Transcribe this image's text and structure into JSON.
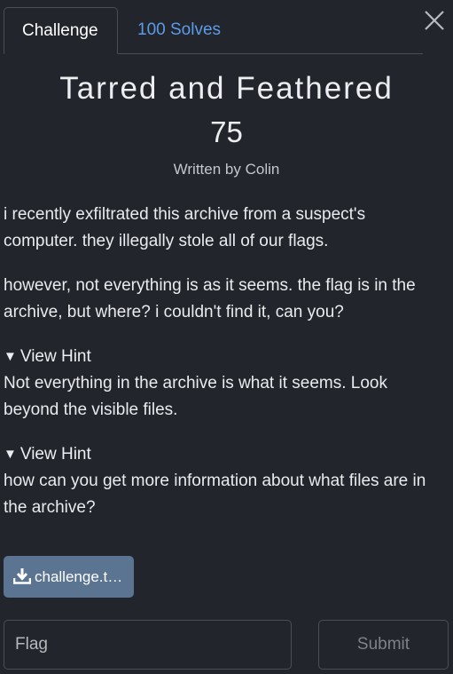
{
  "tabs": {
    "challenge": "Challenge",
    "solves": "100 Solves"
  },
  "challenge": {
    "title": "Tarred and Feathered",
    "points": "75",
    "author": "Written by Colin",
    "description": [
      "i recently exfiltrated this archive from a suspect's computer. they illegally stole all of our flags.",
      "however, not everything is as it seems. the flag is in the archive, but where? i couldn't find it, can you?"
    ]
  },
  "hints": [
    {
      "toggle_icon": "▼",
      "label": "View Hint",
      "text": "Not everything in the archive is what it seems. Look beyond the visible files."
    },
    {
      "toggle_icon": "▼",
      "label": "View Hint",
      "text": "how can you get more information about what files are in the archive?"
    }
  ],
  "files": [
    {
      "icon": "download-icon",
      "label": "challenge.t…"
    }
  ],
  "submission": {
    "placeholder": "Flag",
    "value": "",
    "submit_label": "Submit"
  },
  "icons": {
    "close": "close-icon",
    "download": "download-icon"
  },
  "colors": {
    "background": "#22252b",
    "tab_link": "#5b9ce8",
    "file_button": "#5b7492",
    "submit_disabled_text": "#7d828a"
  }
}
